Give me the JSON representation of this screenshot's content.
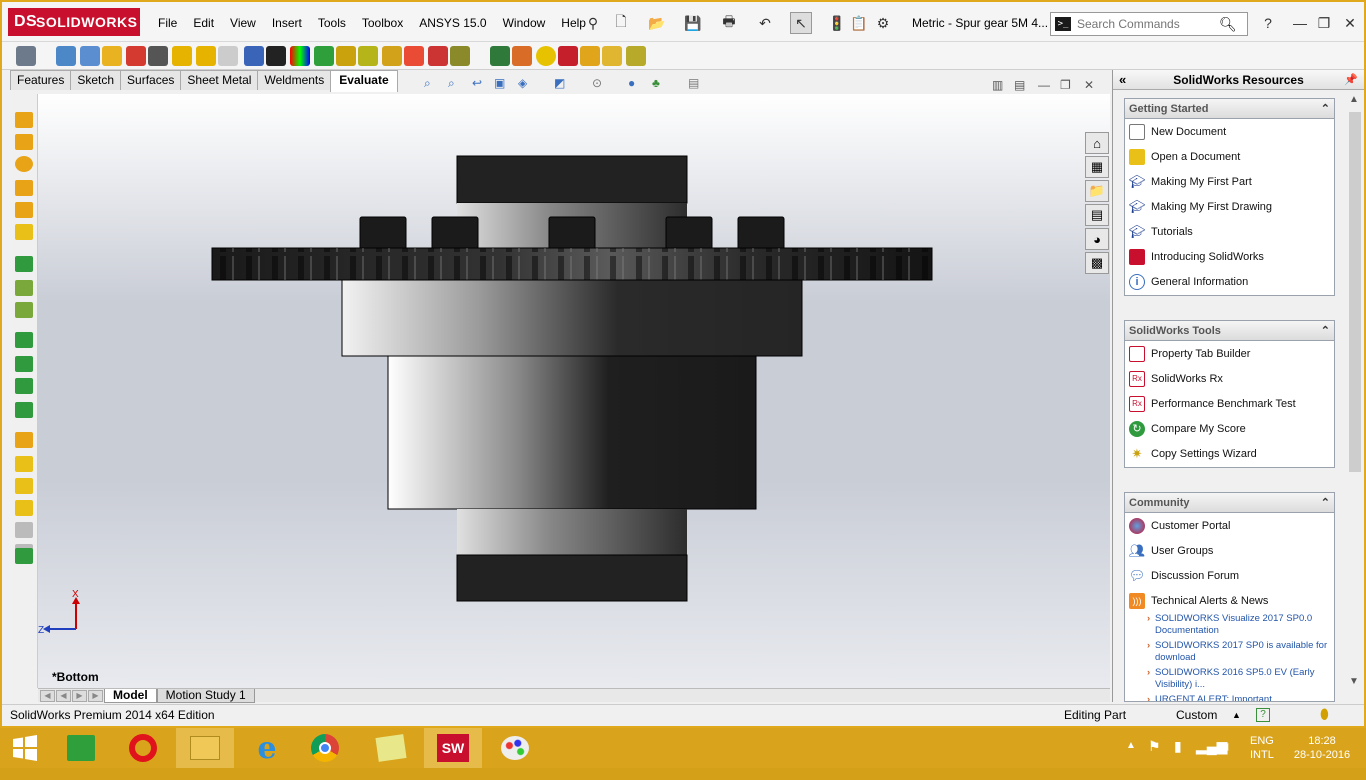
{
  "app": {
    "brand": "SOLIDWORKS",
    "brand_prefix": "DS",
    "document_title": "Metric - Spur gear 5M 4...",
    "menu": [
      "File",
      "Edit",
      "View",
      "Insert",
      "Tools",
      "Toolbox",
      "ANSYS 15.0",
      "Window",
      "Help"
    ],
    "search_placeholder": "Search Commands",
    "prompt_glyph": ">_"
  },
  "command_tabs": [
    "Features",
    "Sketch",
    "Surfaces",
    "Sheet Metal",
    "Weldments",
    "Evaluate"
  ],
  "active_command_tab": "Evaluate",
  "viewport": {
    "view_name": "*Bottom",
    "triad_x": "X",
    "triad_z": "Z"
  },
  "bottom_tabs": [
    "Model",
    "Motion Study 1"
  ],
  "status": {
    "edition": "SolidWorks Premium 2014 x64 Edition",
    "mode": "Editing Part",
    "units": "Custom"
  },
  "task_pane": {
    "title": "SolidWorks Resources",
    "getting_started": {
      "title": "Getting Started",
      "items": [
        "New Document",
        "Open a Document",
        "Making My First Part",
        "Making My First Drawing",
        "Tutorials",
        "Introducing SolidWorks",
        "General Information"
      ]
    },
    "tools": {
      "title": "SolidWorks Tools",
      "items": [
        "Property Tab Builder",
        "SolidWorks Rx",
        "Performance Benchmark Test",
        "Compare My Score",
        "Copy Settings Wizard"
      ]
    },
    "community": {
      "title": "Community",
      "items": [
        "Customer Portal",
        "User Groups",
        "Discussion Forum",
        "Technical Alerts & News"
      ],
      "news": [
        "SOLIDWORKS Visualize 2017 SP0.0 Documentation",
        "SOLIDWORKS 2017 SP0 is available for download",
        "SOLIDWORKS 2016 SP5.0 EV (Early Visibility) i...",
        "URGENT ALERT: Important"
      ]
    }
  },
  "taskbar": {
    "lang": "ENG",
    "layout": "INTL",
    "time": "18:28",
    "date": "28-10-2016",
    "sw_label": "SW"
  },
  "colors": {
    "accent": "#c8102e",
    "taskbar": "#d9a41c",
    "frame": "#e0a81c"
  }
}
